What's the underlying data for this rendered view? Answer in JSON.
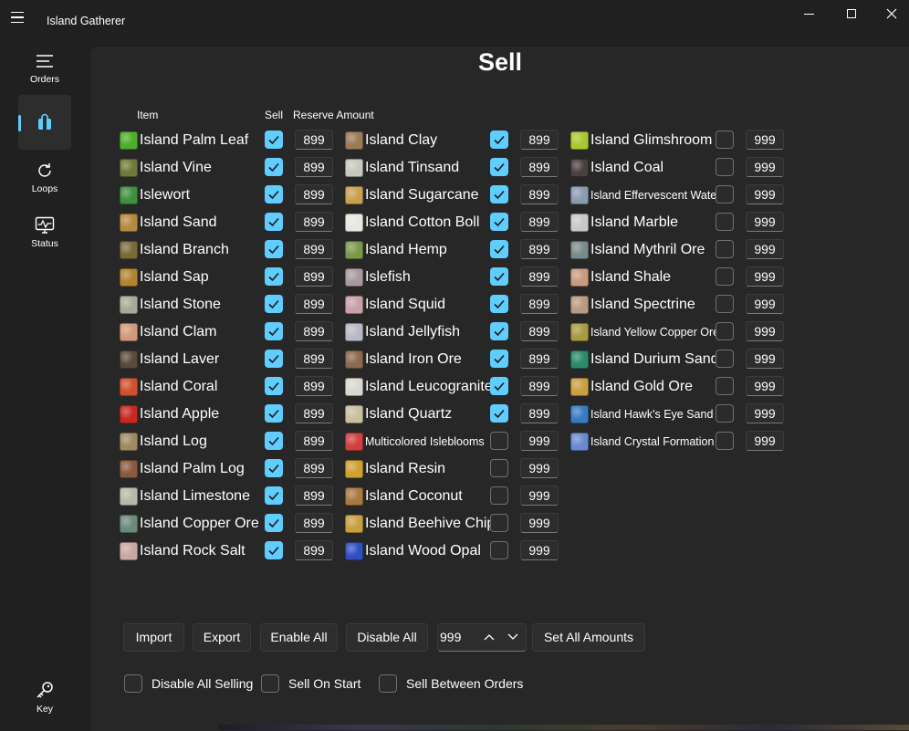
{
  "app": {
    "title": "Island Gatherer"
  },
  "nav": [
    {
      "label": "Orders",
      "icon": "orders-list-icon"
    },
    {
      "label": "",
      "icon": "shopping-bag-icon",
      "active": true
    },
    {
      "label": "Loops",
      "icon": "refresh-loop-icon"
    },
    {
      "label": "Status",
      "icon": "monitor-status-icon"
    },
    {
      "label": "Key",
      "icon": "key-icon"
    }
  ],
  "page": {
    "heading": "Sell"
  },
  "headers": {
    "item": "Item",
    "sell": "Sell",
    "reserve": "Reserve Amount"
  },
  "columns": [
    [
      {
        "name": "Island Palm Leaf",
        "sell": true,
        "amount": "899",
        "color": "#4caf2a"
      },
      {
        "name": "Island Vine",
        "sell": true,
        "amount": "899",
        "color": "#6f7a3a"
      },
      {
        "name": "Islewort",
        "sell": true,
        "amount": "899",
        "color": "#3f8f3f"
      },
      {
        "name": "Island Sand",
        "sell": true,
        "amount": "899",
        "color": "#b58a3e"
      },
      {
        "name": "Island Branch",
        "sell": true,
        "amount": "899",
        "color": "#7a6a3a"
      },
      {
        "name": "Island Sap",
        "sell": true,
        "amount": "899",
        "color": "#b08530"
      },
      {
        "name": "Island Stone",
        "sell": true,
        "amount": "899",
        "color": "#a6ab98"
      },
      {
        "name": "Island Clam",
        "sell": true,
        "amount": "899",
        "color": "#d09a7a"
      },
      {
        "name": "Island Laver",
        "sell": true,
        "amount": "899",
        "color": "#5a4a3a"
      },
      {
        "name": "Island Coral",
        "sell": true,
        "amount": "899",
        "color": "#d0502e"
      },
      {
        "name": "Island Apple",
        "sell": true,
        "amount": "899",
        "color": "#c8281e"
      },
      {
        "name": "Island Log",
        "sell": true,
        "amount": "899",
        "color": "#a08a60"
      },
      {
        "name": "Island Palm Log",
        "sell": true,
        "amount": "899",
        "color": "#8a5a40"
      },
      {
        "name": "Island Limestone",
        "sell": true,
        "amount": "899",
        "color": "#b8b8a8"
      },
      {
        "name": "Island Copper Ore",
        "sell": true,
        "amount": "899",
        "color": "#6a8a7a"
      },
      {
        "name": "Island Rock Salt",
        "sell": true,
        "amount": "899",
        "color": "#c8a8a0"
      }
    ],
    [
      {
        "name": "Island Clay",
        "sell": true,
        "amount": "899",
        "color": "#9a7a58"
      },
      {
        "name": "Island Tinsand",
        "sell": true,
        "amount": "899",
        "color": "#c8c8c0"
      },
      {
        "name": "Island Sugarcane",
        "sell": true,
        "amount": "899",
        "color": "#c8a050"
      },
      {
        "name": "Island Cotton Boll",
        "sell": true,
        "amount": "899",
        "color": "#e8e8e0"
      },
      {
        "name": "Island Hemp",
        "sell": true,
        "amount": "899",
        "color": "#7a9a4a"
      },
      {
        "name": "Islefish",
        "sell": true,
        "amount": "899",
        "color": "#a89aa0"
      },
      {
        "name": "Island Squid",
        "sell": true,
        "amount": "899",
        "color": "#c8a0a8"
      },
      {
        "name": "Island Jellyfish",
        "sell": true,
        "amount": "899",
        "color": "#b8b8c8"
      },
      {
        "name": "Island Iron Ore",
        "sell": true,
        "amount": "899",
        "color": "#8a6a50"
      },
      {
        "name": "Island Leucogranite",
        "sell": true,
        "amount": "899",
        "color": "#d8d8d0"
      },
      {
        "name": "Island Quartz",
        "sell": true,
        "amount": "899",
        "color": "#c8c0a0"
      },
      {
        "name": "Multicolored Isleblooms",
        "sell": false,
        "amount": "999",
        "color": "#d04040",
        "small": true
      },
      {
        "name": "Island Resin",
        "sell": false,
        "amount": "999",
        "color": "#d0a030"
      },
      {
        "name": "Island Coconut",
        "sell": false,
        "amount": "999",
        "color": "#a87a40"
      },
      {
        "name": "Island Beehive Chip",
        "sell": false,
        "amount": "999",
        "color": "#c8a040"
      },
      {
        "name": "Island Wood Opal",
        "sell": false,
        "amount": "999",
        "color": "#3050c0"
      }
    ],
    [
      {
        "name": "Island Glimshroom",
        "sell": false,
        "amount": "999",
        "color": "#a8c830"
      },
      {
        "name": "Island Coal",
        "sell": false,
        "amount": "999",
        "color": "#4a4040"
      },
      {
        "name": "Island Effervescent Water",
        "sell": false,
        "amount": "999",
        "color": "#8a9ab0",
        "small": true
      },
      {
        "name": "Island Marble",
        "sell": false,
        "amount": "999",
        "color": "#c8c8c8"
      },
      {
        "name": "Island Mythril Ore",
        "sell": false,
        "amount": "999",
        "color": "#7a8a8a"
      },
      {
        "name": "Island Shale",
        "sell": false,
        "amount": "999",
        "color": "#c89a80"
      },
      {
        "name": "Island Spectrine",
        "sell": false,
        "amount": "999",
        "color": "#b89a80"
      },
      {
        "name": "Island Yellow Copper Ore",
        "sell": false,
        "amount": "999",
        "color": "#a89a40",
        "small": true
      },
      {
        "name": "Island Durium Sand",
        "sell": false,
        "amount": "999",
        "color": "#2a8a6a"
      },
      {
        "name": "Island Gold Ore",
        "sell": false,
        "amount": "999",
        "color": "#c8a040"
      },
      {
        "name": "Island Hawk's Eye Sand",
        "sell": false,
        "amount": "999",
        "color": "#3a7ac0",
        "small": true
      },
      {
        "name": "Island Crystal Formation",
        "sell": false,
        "amount": "999",
        "color": "#6a8ad0",
        "small": true
      }
    ]
  ],
  "toolbar": {
    "import": "Import",
    "export": "Export",
    "enable_all": "Enable All",
    "disable_all": "Disable All",
    "amount_value": "999",
    "set_all": "Set All Amounts"
  },
  "options": {
    "disable_all_selling": "Disable All Selling",
    "sell_on_start": "Sell On Start",
    "sell_between_orders": "Sell Between Orders"
  }
}
